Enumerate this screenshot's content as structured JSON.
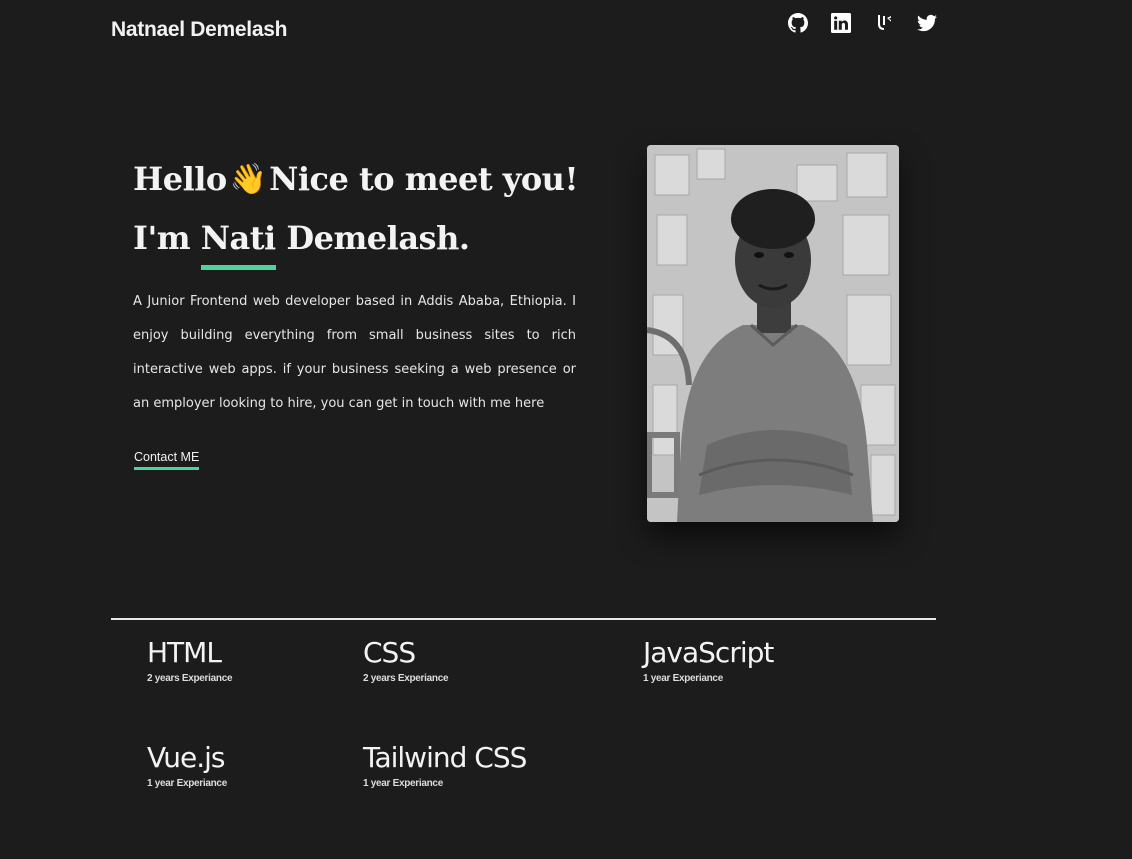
{
  "header": {
    "brand": "Natnael Demelash",
    "social": [
      {
        "icon": "github-icon"
      },
      {
        "icon": "linkedin-icon"
      },
      {
        "icon": "codepen-icon"
      },
      {
        "icon": "twitter-icon"
      }
    ]
  },
  "hero": {
    "greeting_hello": "Hello",
    "wave_emoji": "👋",
    "greeting_rest": "Nice to meet you!",
    "im": "I'm",
    "first_name": "Nati",
    "last_name": "Demelash.",
    "intro": "A Junior Frontend web developer based in Addis Ababa, Ethiopia. I enjoy building everything from small business sites to rich interactive web apps. if your business seeking a web presence or an employer looking to hire, you can get in touch with me here",
    "contact_label": "Contact ME"
  },
  "skills": [
    {
      "name": "HTML",
      "experience": "2 years Experiance"
    },
    {
      "name": "CSS",
      "experience": "2 years Experiance"
    },
    {
      "name": "JavaScript",
      "experience": "1 year Experiance"
    },
    {
      "name": "Vue.js",
      "experience": "1 year Experiance"
    },
    {
      "name": "Tailwind CSS",
      "experience": "1 year Experiance"
    }
  ],
  "colors": {
    "background": "#1c1c1c",
    "accent": "#4fd39a",
    "text": "#f3f3f3"
  }
}
